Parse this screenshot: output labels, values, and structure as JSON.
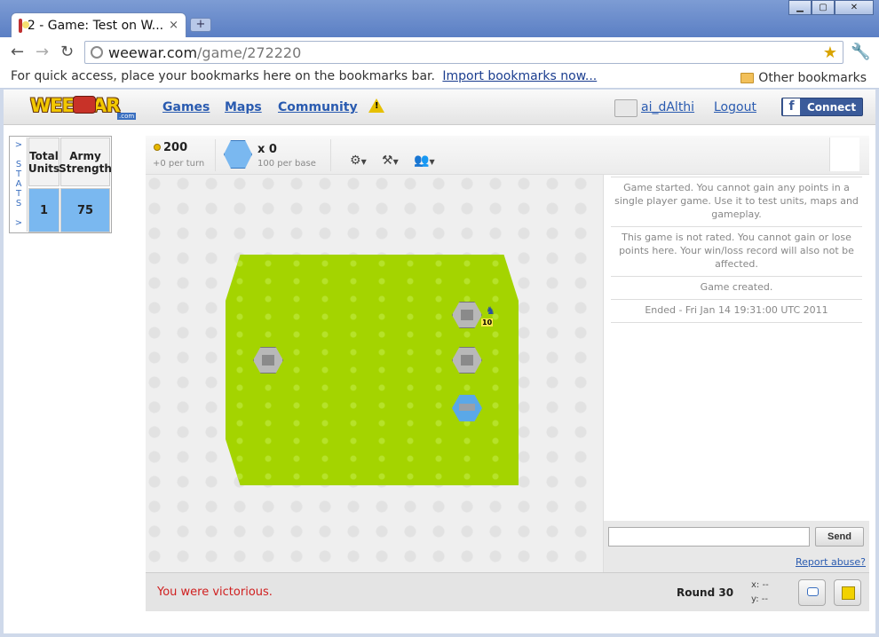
{
  "browser": {
    "tab_title": "2 - Game: Test on W...",
    "tab_close": "×",
    "new_tab": "+",
    "url_host": "weewar.com",
    "url_path": "/game/272220",
    "bookmarks_hint": "For quick access, place your bookmarks here on the bookmarks bar.",
    "bookmarks_import": "Import bookmarks now...",
    "other_bookmarks": "Other bookmarks",
    "win_min": "▁",
    "win_max": "▢",
    "win_close": "✕"
  },
  "site": {
    "logo_text": "WEEWAR",
    "logo_sub": ".com",
    "nav": [
      "Games",
      "Maps",
      "Community"
    ],
    "username": "ai_dAlthi",
    "logout": "Logout",
    "fb_connect": "Connect",
    "fb_letter": "f"
  },
  "stats": {
    "tab_label": "> S T A T S >",
    "headers": [
      "Total Units",
      "Army Strength"
    ],
    "values": [
      "1",
      "75"
    ]
  },
  "game": {
    "credits": "200",
    "per_turn": "+0 per turn",
    "bases": "x 0",
    "per_base": "100 per base",
    "unit_strength": "10"
  },
  "log": {
    "entries": [
      "Game started. You cannot gain any points in a single player game. Use it to test units, maps and gameplay.",
      "This game is not rated. You cannot gain or lose points here. Your win/loss record will also not be affected.",
      "Game created.",
      "Ended - Fri Jan 14 19:31:00 UTC 2011"
    ]
  },
  "chat": {
    "send": "Send",
    "report": "Report abuse?"
  },
  "status": {
    "message": "You were victorious.",
    "round": "Round 30",
    "x": "x: --",
    "y": "y: --"
  }
}
